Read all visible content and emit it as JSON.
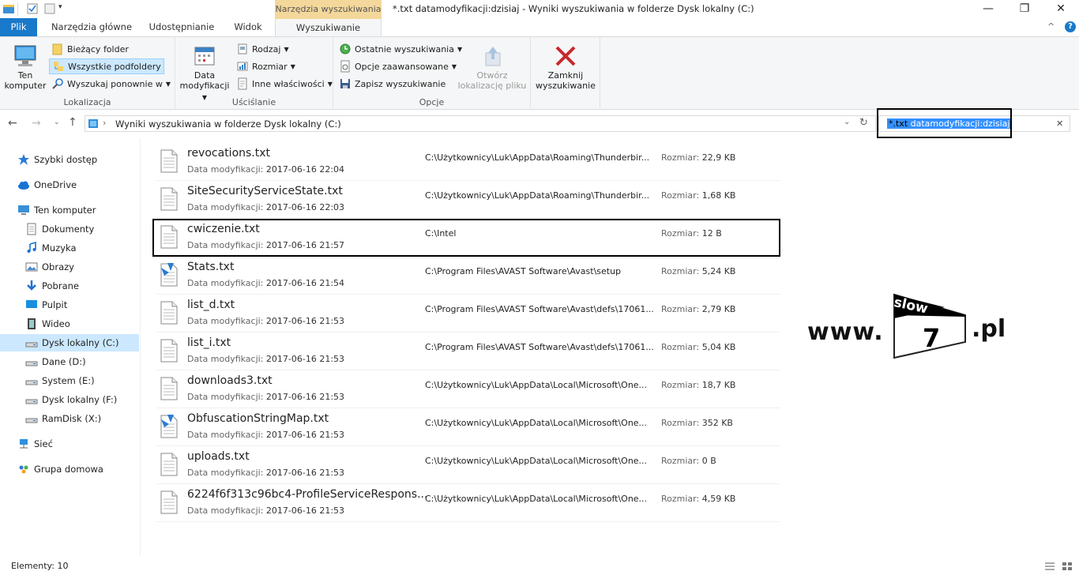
{
  "titlebar": {
    "context_tab_label": "Narzędzia wyszukiwania",
    "window_title": "*.txt datamodyfikacji:dzisiaj - Wyniki wyszukiwania w folderze Dysk lokalny (C:)",
    "minimize": "—",
    "maximize": "❐",
    "close": "✕"
  },
  "tabs": {
    "file": "Plik",
    "home": "Narzędzia główne",
    "share": "Udostępnianie",
    "view": "Widok",
    "search": "Wyszukiwanie"
  },
  "ribbon": {
    "location": {
      "label": "Lokalizacja",
      "this_pc": "Ten\nkomputer",
      "current_folder": "Bieżący folder",
      "all_subfolders": "Wszystkie podfoldery",
      "search_again": "Wyszukaj ponownie w"
    },
    "refine": {
      "label": "Uściślanie",
      "date_modified": "Data\nmodyfikacji",
      "kind": "Rodzaj",
      "size": "Rozmiar",
      "other_properties": "Inne właściwości"
    },
    "options": {
      "label": "Opcje",
      "recent_searches": "Ostatnie wyszukiwania",
      "advanced_options": "Opcje zaawansowane",
      "save_search": "Zapisz wyszukiwanie",
      "open_file_location": "Otwórz\nlokalizację pliku"
    },
    "close": {
      "close_search": "Zamknij\nwyszukiwanie"
    }
  },
  "address": {
    "path": "Wyniki wyszukiwania w folderze Dysk lokalny (C:)",
    "search_query_part1": "*.txt",
    "search_query_part2": " datamodyfikacji:dzisiaj"
  },
  "nav": {
    "items": [
      {
        "label": "Szybki dostęp",
        "icon": "star-icon"
      },
      {
        "label": "OneDrive",
        "icon": "cloud-icon"
      },
      {
        "label": "Ten komputer",
        "icon": "computer-icon"
      },
      {
        "label": "Dokumenty",
        "icon": "documents-icon"
      },
      {
        "label": "Muzyka",
        "icon": "music-icon"
      },
      {
        "label": "Obrazy",
        "icon": "pictures-icon"
      },
      {
        "label": "Pobrane",
        "icon": "download-icon"
      },
      {
        "label": "Pulpit",
        "icon": "desktop-icon"
      },
      {
        "label": "Wideo",
        "icon": "video-icon"
      },
      {
        "label": "Dysk lokalny (C:)",
        "icon": "drive-icon"
      },
      {
        "label": "Dane (D:)",
        "icon": "drive-icon"
      },
      {
        "label": "System (E:)",
        "icon": "drive-icon"
      },
      {
        "label": "Dysk lokalny (F:)",
        "icon": "drive-icon"
      },
      {
        "label": "RamDisk (X:)",
        "icon": "drive-icon"
      },
      {
        "label": "Sieć",
        "icon": "network-icon"
      },
      {
        "label": "Grupa domowa",
        "icon": "homegroup-icon"
      }
    ]
  },
  "results": {
    "date_label": "Data modyfikacji:",
    "size_label": "Rozmiar:",
    "files": [
      {
        "name": "revocations.txt",
        "date": "2017-06-16 22:04",
        "path": "C:\\Użytkownicy\\Luk\\AppData\\Roaming\\Thunderbir...",
        "size": "22,9 KB"
      },
      {
        "name": "SiteSecurityServiceState.txt",
        "date": "2017-06-16 22:03",
        "path": "C:\\Użytkownicy\\Luk\\AppData\\Roaming\\Thunderbir...",
        "size": "1,68 KB"
      },
      {
        "name": "cwiczenie.txt",
        "date": "2017-06-16 21:57",
        "path": "C:\\Intel",
        "size": "12 B"
      },
      {
        "name": "Stats.txt",
        "date": "2017-06-16 21:54",
        "path": "C:\\Program Files\\AVAST Software\\Avast\\setup",
        "size": "5,24 KB"
      },
      {
        "name": "list_d.txt",
        "date": "2017-06-16 21:53",
        "path": "C:\\Program Files\\AVAST Software\\Avast\\defs\\17061...",
        "size": "2,79 KB"
      },
      {
        "name": "list_i.txt",
        "date": "2017-06-16 21:53",
        "path": "C:\\Program Files\\AVAST Software\\Avast\\defs\\17061...",
        "size": "5,04 KB"
      },
      {
        "name": "downloads3.txt",
        "date": "2017-06-16 21:53",
        "path": "C:\\Użytkownicy\\Luk\\AppData\\Local\\Microsoft\\One...",
        "size": "18,7 KB"
      },
      {
        "name": "ObfuscationStringMap.txt",
        "date": "2017-06-16 21:53",
        "path": "C:\\Użytkownicy\\Luk\\AppData\\Local\\Microsoft\\One...",
        "size": "352 KB"
      },
      {
        "name": "uploads.txt",
        "date": "2017-06-16 21:53",
        "path": "C:\\Użytkownicy\\Luk\\AppData\\Local\\Microsoft\\One...",
        "size": "0 B"
      },
      {
        "name": "6224f6f313c96bc4-ProfileServiceRespons...",
        "date": "2017-06-16 21:53",
        "path": "C:\\Użytkownicy\\Luk\\AppData\\Local\\Microsoft\\One...",
        "size": "4,59 KB"
      }
    ]
  },
  "status": {
    "items_count": "Elementy: 10"
  },
  "watermark": {
    "www": "www.",
    "slow": "slow",
    "seven": "7",
    "pl": ".pl"
  },
  "colors": {
    "file_tab": "#1979ca",
    "context_tab": "#f4d79a",
    "selection": "#cce8ff"
  }
}
